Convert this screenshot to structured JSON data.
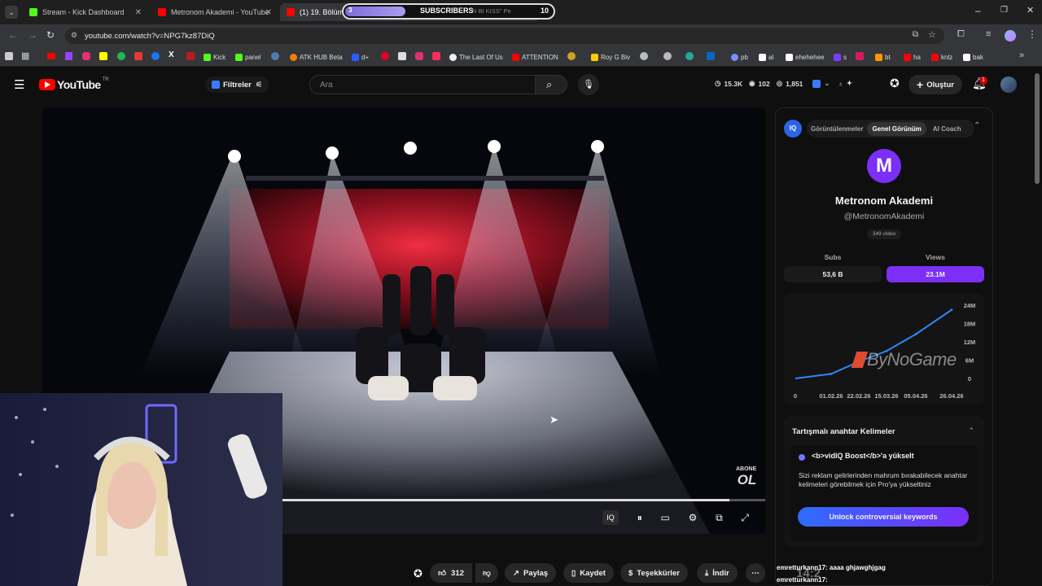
{
  "tabs": [
    {
      "label": "Stream - Kick Dashboard",
      "color": "#53fc18"
    },
    {
      "label": "Metronom Akademi - YouTube",
      "color": "#ff0000"
    },
    {
      "label": "(1) 19. Bölüm \"A",
      "color": "#ff0000"
    }
  ],
  "overlay": {
    "count_left": "3",
    "label": "SUBSCRIBERS",
    "tail_text": "N Bİ KISS\" Pe",
    "count_right": "10"
  },
  "address": {
    "url": "youtube.com/watch?v=NPG7kz87DiQ"
  },
  "bookmarks": [
    {
      "label": "Kick",
      "color": "#53fc18"
    },
    {
      "label": "panel",
      "color": "#53fc18"
    },
    {
      "label": "ATK HUB Beta",
      "color": "#f57c00"
    },
    {
      "label": "d+",
      "color": "#2b5cff"
    },
    {
      "label": "The Last Of Us",
      "color": "#eeeeee"
    },
    {
      "label": "ATTENTION",
      "color": "#ff0000"
    },
    {
      "label": "Roy G Biv",
      "color": "#ffcc00"
    },
    {
      "label": "pb",
      "color": "#7a8cff"
    },
    {
      "label": "al",
      "color": "#ffffff"
    },
    {
      "label": "ehehehee",
      "color": "#ffffff"
    },
    {
      "label": "s",
      "color": "#7b3cff"
    },
    {
      "label": "bt",
      "color": "#ff9800"
    },
    {
      "label": "ha",
      "color": "#ff0000"
    },
    {
      "label": "knlz",
      "color": "#ff0000"
    },
    {
      "label": "bak",
      "color": "#ffffff"
    }
  ],
  "yt": {
    "logo": "YouTube",
    "logo_sup": "TR",
    "filters": "Filtreler",
    "search_placeholder": "Ara",
    "stats": {
      "views": "15.3K",
      "likes": "102",
      "subs": "1,851"
    },
    "create": "Oluştur",
    "notif_count": "1"
  },
  "video": {
    "abone": "ABONE",
    "ol": "OL",
    "progress": 0.95
  },
  "actions": {
    "likes": "312",
    "share": "Paylaş",
    "save": "Kaydet",
    "thanks": "Teşekkürler",
    "download": "İndir"
  },
  "vidiq": {
    "tabs": [
      "Görüntülenmeler",
      "Genel Görünüm",
      "AI Coach"
    ],
    "active_tab": 1,
    "channel_name": "Metronom Akademi",
    "handle": "@MetronomAkademi",
    "video_count": "349 video",
    "subs_label": "Subs",
    "views_label": "Views",
    "subs_value": "53,6 B",
    "views_value": "23.1M",
    "accent": "#7b2ff7",
    "chart": {
      "y_ticks": [
        "24M",
        "18M",
        "12M",
        "6M",
        "0"
      ],
      "x_ticks": [
        "0",
        "01.02.26",
        "22.02.26",
        "15.03.26",
        "05.04.26",
        "26.04.26"
      ]
    },
    "section_title": "Tartışmalı anahtar Kelimeler",
    "boost_title": "<b>vidIQ Boost</b>'a yükselt",
    "boost_text": "Sizi reklam gelirlerinden mahrum bırakabilecek anahtar kelimeleri görebilmek için Pro'ya yükseltiniz",
    "unlock": "Unlock controversial keywords"
  },
  "chat": [
    {
      "user": "emretturkann17",
      "msg": ": aaaa ghjawghjgag"
    },
    {
      "user": "emretturkann17",
      "msg": ":"
    }
  ],
  "watermark": "ByNoGame",
  "clock": "14:2",
  "chart_data": {
    "type": "line",
    "x": [
      "01.02.26",
      "22.02.26",
      "15.03.26",
      "05.04.26",
      "26.04.26"
    ],
    "series": [
      {
        "values": [
          1.5,
          5.5,
          9,
          14.5,
          22.5
        ]
      }
    ],
    "ylim": [
      0,
      24
    ],
    "y_ticks": [
      "0",
      "6M",
      "12M",
      "18M",
      "24M"
    ]
  }
}
